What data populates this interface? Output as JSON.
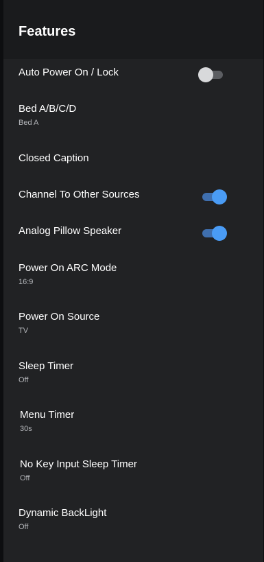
{
  "header": {
    "title": "Features"
  },
  "items": [
    {
      "label": "Auto Power On / Lock",
      "toggle": false
    },
    {
      "label": "Bed A/B/C/D",
      "value": "Bed A"
    },
    {
      "label": "Closed Caption"
    },
    {
      "label": "Channel To Other Sources",
      "toggle": true
    },
    {
      "label": "Analog Pillow Speaker",
      "toggle": true
    },
    {
      "label": "Power On ARC Mode",
      "value": "16:9"
    },
    {
      "label": "Power On Source",
      "value": "TV"
    },
    {
      "label": "Sleep Timer",
      "value": "Off"
    },
    {
      "label": "Menu Timer",
      "value": "30s"
    },
    {
      "label": "No Key Input Sleep Timer",
      "value": "Off"
    },
    {
      "label": "Dynamic BackLight",
      "value": "Off"
    }
  ],
  "colors": {
    "toggle_on": "#4a9cf5",
    "toggle_off": "#d8d9db",
    "panel_background": "#212224"
  }
}
